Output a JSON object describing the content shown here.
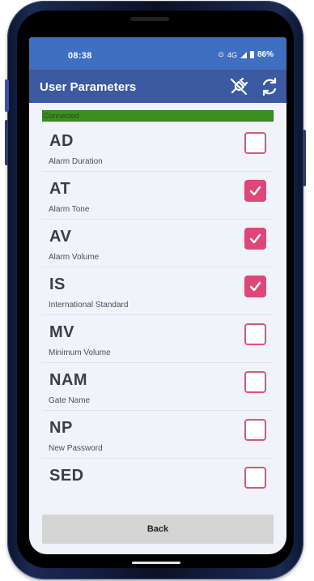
{
  "status_bar": {
    "time": "08:38",
    "network": "4G",
    "battery": "86%",
    "icons": [
      "alarm-icon",
      "signal-icon",
      "battery-icon"
    ]
  },
  "app_bar": {
    "title": "User Parameters",
    "actions": [
      {
        "icon": "unplug-icon"
      },
      {
        "icon": "refresh-icon"
      }
    ]
  },
  "connection": {
    "status": "Connected",
    "color": "#3a8f20"
  },
  "parameters": [
    {
      "code": "AD",
      "label": "Alarm Duration",
      "checked": false
    },
    {
      "code": "AT",
      "label": "Alarm Tone",
      "checked": true
    },
    {
      "code": "AV",
      "label": "Alarm Volume",
      "checked": true
    },
    {
      "code": "IS",
      "label": "International Standard",
      "checked": true
    },
    {
      "code": "MV",
      "label": "Minimum Volume",
      "checked": false
    },
    {
      "code": "NAM",
      "label": "Gate Name",
      "checked": false
    },
    {
      "code": "NP",
      "label": "New Password",
      "checked": false
    },
    {
      "code": "SED",
      "label": "",
      "checked": false
    }
  ],
  "back_button": {
    "label": "Back"
  },
  "colors": {
    "app_bar": "#3b5aa1",
    "status_bar": "#3f6fc1",
    "checkbox_accent": "#e0467a",
    "background": "#f1f3fa"
  }
}
